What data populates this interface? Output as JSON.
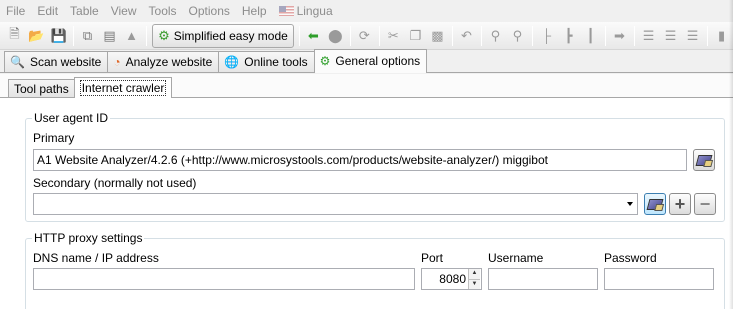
{
  "menubar": {
    "items": [
      {
        "label": "File",
        "mnemonic": "F"
      },
      {
        "label": "Edit",
        "mnemonic": "E"
      },
      {
        "label": "Table",
        "mnemonic": "T"
      },
      {
        "label": "View",
        "mnemonic": "V"
      },
      {
        "label": "Tools",
        "mnemonic": "o"
      },
      {
        "label": "Options",
        "mnemonic": "O"
      },
      {
        "label": "Help",
        "mnemonic": "H"
      },
      {
        "label": "Lingua",
        "mnemonic": ""
      }
    ]
  },
  "toolbar": {
    "easy_mode_label": "Simplified easy mode"
  },
  "tabs": {
    "main": [
      {
        "label": "Scan website",
        "icon": "magnifier-icon"
      },
      {
        "label": "Analyze website",
        "icon": "pie-chart-icon"
      },
      {
        "label": "Online tools",
        "icon": "globe-icon"
      },
      {
        "label": "General options",
        "icon": "gears-icon",
        "active": true
      }
    ],
    "sub": [
      {
        "label": "Tool paths"
      },
      {
        "label": "Internet crawler",
        "active": true
      }
    ]
  },
  "user_agent": {
    "group_title": "User agent ID",
    "primary_label": "Primary",
    "primary_value": "A1 Website Analyzer/4.2.6 (+http://www.microsystools.com/products/website-analyzer/) miggibot",
    "secondary_label": "Secondary (normally not used)",
    "secondary_value": ""
  },
  "proxy": {
    "group_title": "HTTP proxy settings",
    "dns_label": "DNS name / IP address",
    "dns_value": "",
    "port_label": "Port",
    "port_value": "8080",
    "username_label": "Username",
    "username_value": "",
    "password_label": "Password",
    "password_value": ""
  }
}
